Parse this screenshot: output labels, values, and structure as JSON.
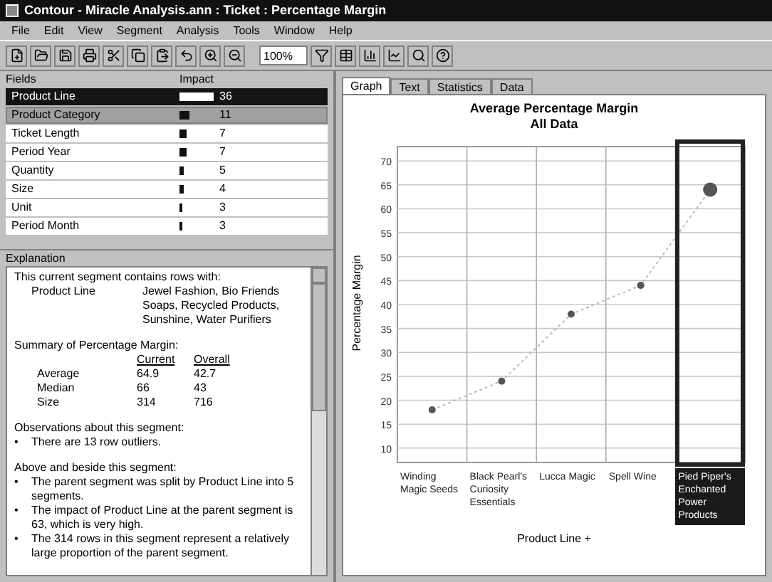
{
  "window": {
    "title": "Contour - Miracle Analysis.ann : Ticket : Percentage Margin"
  },
  "menu": [
    "File",
    "Edit",
    "View",
    "Segment",
    "Analysis",
    "Tools",
    "Window",
    "Help"
  ],
  "toolbar": {
    "zoom_field": {
      "value": "100%"
    }
  },
  "fields": {
    "columns": [
      "Fields",
      "Impact"
    ],
    "rows": [
      {
        "name": "Product Line",
        "value": "36",
        "selected": true,
        "highlighted": false
      },
      {
        "name": "Product Category",
        "value": "11",
        "selected": false,
        "highlighted": true
      },
      {
        "name": "Ticket Length",
        "value": "7",
        "selected": false,
        "highlighted": false
      },
      {
        "name": "Period Year",
        "value": "7",
        "selected": false,
        "highlighted": false
      },
      {
        "name": "Quantity",
        "value": "5",
        "selected": false,
        "highlighted": false
      },
      {
        "name": "Size",
        "value": "4",
        "selected": false,
        "highlighted": false
      },
      {
        "name": "Unit",
        "value": "3",
        "selected": false,
        "highlighted": false
      },
      {
        "name": "Period Month",
        "value": "3",
        "selected": false,
        "highlighted": false
      }
    ]
  },
  "explanation": {
    "title": "Explanation",
    "intro": "This current segment contains rows with:",
    "segment_field": "Product Line",
    "segment_values": "Jewel Fashion, Bio Friends Soaps, Recycled Products, Sunshine, Water Purifiers",
    "summary_title": "Summary of Percentage Margin:",
    "summary_columns": [
      "Current",
      "Overall"
    ],
    "summary_rows": [
      {
        "label": "Average",
        "current": "64.9",
        "overall": "42.7"
      },
      {
        "label": "Median",
        "current": "66",
        "overall": "43"
      },
      {
        "label": "Size",
        "current": "314",
        "overall": "716"
      }
    ],
    "bullet": "•",
    "observations_title": "Observations about this segment:",
    "observations": [
      "There are 13 row outliers."
    ],
    "context_title": "Above and beside this segment:",
    "context": [
      "The parent segment was split by Product Line into 5 segments.",
      "The impact of Product Line at the parent segment is 63, which is very high.",
      "The 314 rows in this segment represent a relatively large proportion of the parent segment."
    ]
  },
  "tabs": [
    {
      "label": "Graph",
      "selected": true
    },
    {
      "label": "Text",
      "selected": false
    },
    {
      "label": "Statistics",
      "selected": false
    },
    {
      "label": "Data",
      "selected": false
    }
  ],
  "graph_columns": [
    {
      "selected": false
    },
    {
      "selected": false
    },
    {
      "selected": false
    },
    {
      "selected": false
    },
    {
      "selected": true
    }
  ],
  "chart_data": {
    "type": "line",
    "title": "Average Percentage Margin",
    "subtitle": "All Data",
    "xlabel": "Product Line +",
    "ylabel": "Percentage Margin",
    "categories": [
      "Winding Magic Seeds",
      "Black Pearl's Curiosity Essentials",
      "Lucca Magic",
      "Spell Wine",
      "Pied Piper's Enchanted Power Products"
    ],
    "grid": true,
    "series": [
      {
        "color": "#555555",
        "line_style": "dotted",
        "marker": "o",
        "values": [
          18,
          24,
          38,
          44,
          64
        ]
      }
    ],
    "ylim": [
      7,
      73
    ],
    "yticks": [
      10,
      15,
      20,
      25,
      30,
      35,
      40,
      45,
      50,
      55,
      60,
      65,
      70
    ]
  }
}
